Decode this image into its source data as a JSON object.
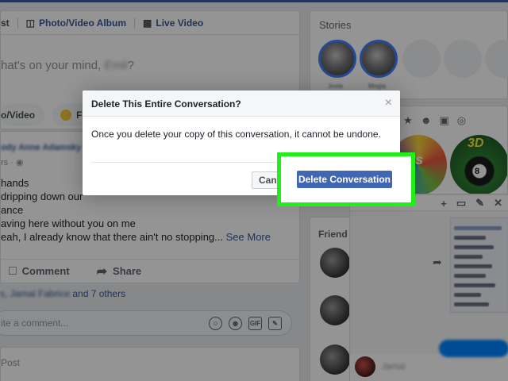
{
  "composer": {
    "tabs": [
      {
        "label": "st",
        "icon": "edit-icon"
      },
      {
        "label": "Photo/Video Album",
        "icon": "album-icon"
      },
      {
        "label": "Live Video",
        "icon": "video-icon"
      }
    ],
    "prompt_prefix": "hat's on your mind, ",
    "prompt_name": "Emil",
    "prompt_suffix": "?",
    "pills": [
      {
        "label": "o/Video"
      },
      {
        "label": "Fee",
        "icon": "feeling-icon"
      }
    ]
  },
  "post": {
    "author": "ody Anne Adamsky",
    "meta": "rs · ",
    "lines": [
      "hands",
      "dripping down our",
      "ance",
      "aving here without you on me",
      "eah, I already know that there ain't no stopping..."
    ],
    "see_more": "See More",
    "actions": [
      {
        "label": "Comment",
        "icon": "comment-icon"
      },
      {
        "label": "Share",
        "icon": "share-icon"
      }
    ],
    "likes_names": "s, Jamal Fabrice",
    "likes_rest": " and 7 others",
    "comment_placeholder": "ite a comment...",
    "comment_icons": [
      "emoji-icon",
      "camera-icon",
      "gif-icon",
      "sticker-icon"
    ],
    "comment_icon_text": [
      "☺",
      "◉",
      "GIF",
      "✎"
    ]
  },
  "post2": {
    "label": "Post"
  },
  "stories": {
    "title": "Stories",
    "names": [
      "Jovia",
      "Mogia"
    ]
  },
  "games": {
    "game1_text": "RKS",
    "game2_text": "3D",
    "game2_ball": "8"
  },
  "friends": {
    "title": "Friend"
  },
  "chat": {
    "icons": [
      "+",
      "▭",
      "✎",
      "✕"
    ],
    "contact_name": "Jamal"
  },
  "modal": {
    "title": "Delete This Entire Conversation?",
    "close": "×",
    "body": "Once you delete your copy of this conversation, it cannot be undone.",
    "cancel_label": "Cancel",
    "delete_label": "Delete Conversation"
  },
  "colors": {
    "facebook_blue": "#4267b2",
    "link_blue": "#365899",
    "highlight_green": "#22ee1a"
  }
}
